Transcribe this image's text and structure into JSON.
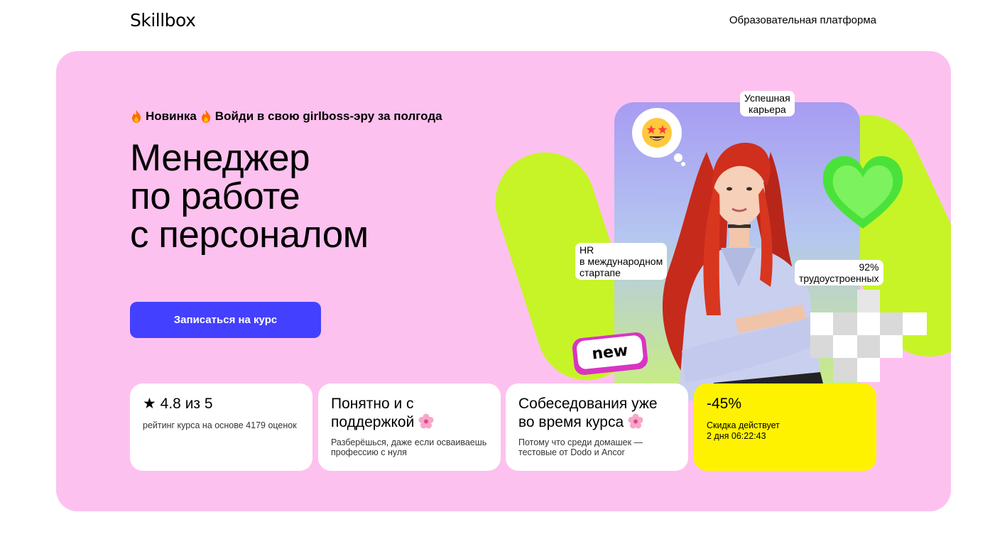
{
  "header": {
    "logo": "Skillbox",
    "platform_link": "Образовательная платформа"
  },
  "hero": {
    "promo_new": "Новинка",
    "promo_text": "Войди в свою girlboss-эру за полгода",
    "title_lines": [
      "Менеджер",
      "по работе",
      "с персоналом"
    ],
    "cta_label": "Записаться на курс",
    "stickers": {
      "career": [
        "Успешная",
        "карьера"
      ],
      "hr": [
        "HR",
        "в международном",
        "стартапе"
      ],
      "employed": [
        "92%",
        "трудоустроенных"
      ],
      "new": "new"
    }
  },
  "cards": {
    "rating": {
      "title": "★ 4.8 из 5",
      "desc": "рейтинг курса на основе 4179 оценок"
    },
    "support": {
      "title_line1": "Понятно и с",
      "title_line2": "поддержкой",
      "desc": "Разберёшься, даже если осваиваешь профессию с нуля"
    },
    "interviews": {
      "title_line1": "Собеседования уже",
      "title_line2": "во время курса",
      "desc": "Потому что среди домашек — тестовые от Dodo и Ancor"
    },
    "discount": {
      "title": "-45%",
      "label": "Скидка  действует",
      "timer": "2 дня 06:22:43"
    }
  },
  "colors": {
    "hero_bg": "#fdc1ef",
    "accent_button": "#4340ff",
    "lime": "#c7f427",
    "discount_bg": "#fff200"
  },
  "icons": [
    "fire-icon",
    "star-eyes-icon",
    "heart-icon",
    "flower-icon"
  ]
}
